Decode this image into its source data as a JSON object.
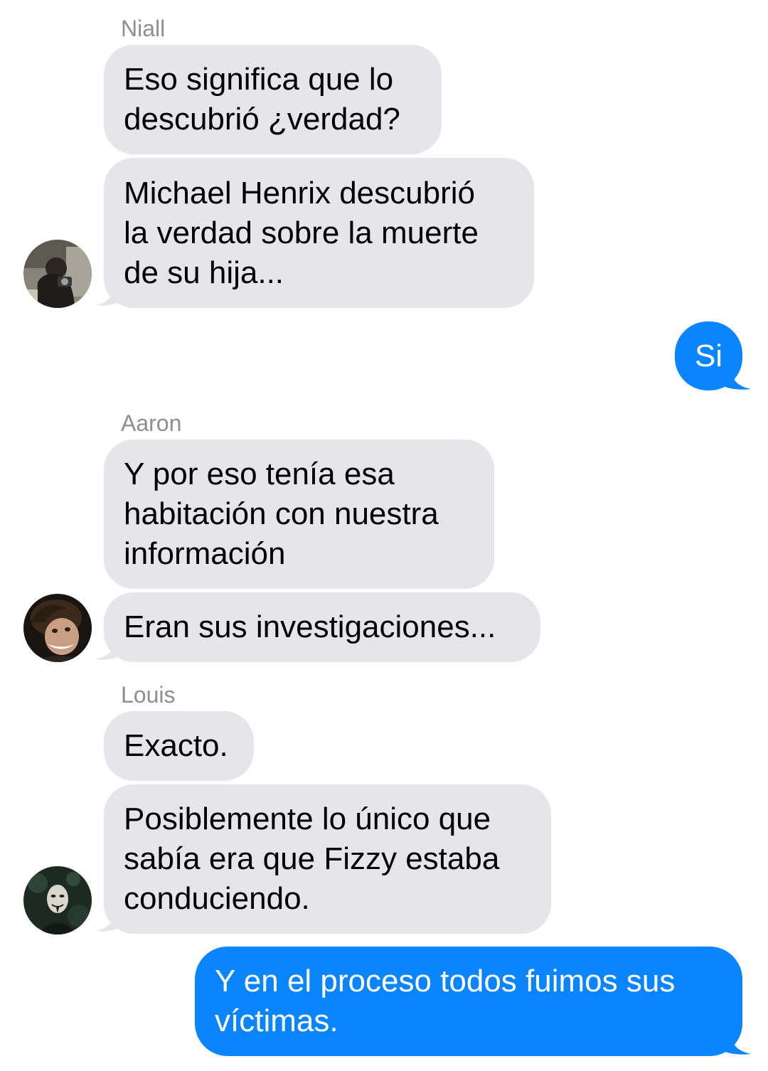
{
  "conversation": {
    "groups": [
      {
        "sender": "Niall",
        "avatar_icon": "contact-photo-icon",
        "messages": [
          "Eso significa que lo\ndescubrió ¿verdad?",
          "Michael Henrix descubrió\nla verdad sobre la muerte\nde su hija..."
        ]
      },
      {
        "sender": "Aaron",
        "avatar_icon": "contact-photo-icon",
        "messages": [
          "Y por eso tenía esa\nhabitación con nuestra\ninformación",
          "Eran sus investigaciones..."
        ]
      },
      {
        "sender": "Louis",
        "avatar_icon": "contact-photo-icon",
        "messages": [
          "Exacto.",
          "Posiblemente lo único que\nsabía era que Fizzy estaba\nconduciendo."
        ]
      }
    ],
    "outgoing": [
      "Si",
      "Y en el proceso todos fuimos sus\nvíctimas."
    ]
  },
  "colors": {
    "incoming_bubble": "#e5e5ea",
    "outgoing_bubble": "#0a84ff",
    "sender_label": "#8e8e93"
  }
}
